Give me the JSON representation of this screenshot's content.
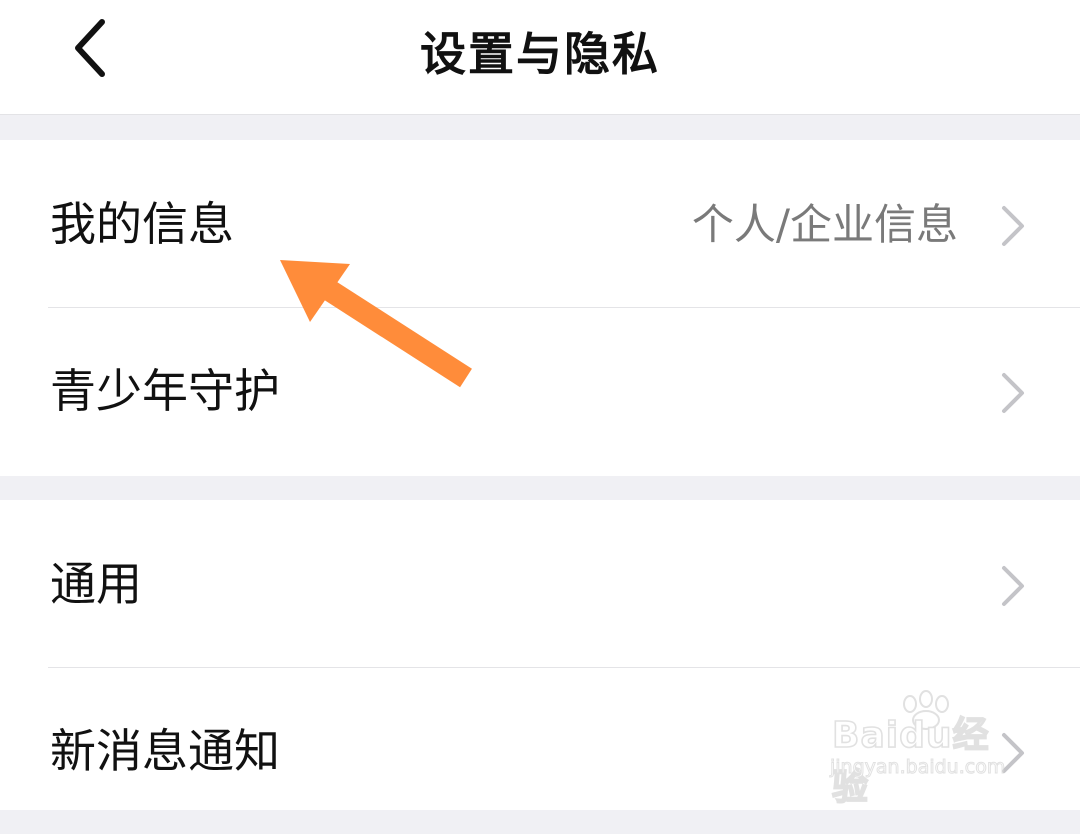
{
  "header": {
    "title": "设置与隐私",
    "back_icon": "chevron-left-icon"
  },
  "groups": [
    {
      "items": [
        {
          "label": "我的信息",
          "value": "个人/企业信息",
          "icon": "chevron-right-icon"
        },
        {
          "label": "青少年守护",
          "value": "",
          "icon": "chevron-right-icon"
        }
      ]
    },
    {
      "items": [
        {
          "label": "通用",
          "value": "",
          "icon": "chevron-right-icon"
        },
        {
          "label": "新消息通知",
          "value": "",
          "icon": "chevron-right-icon"
        }
      ]
    }
  ],
  "annotation": {
    "type": "arrow",
    "color": "#ff8c3a",
    "points_to": "我的信息"
  },
  "watermark": {
    "brand": "Baidu经验",
    "url": "jingyan.baidu.com"
  },
  "colors": {
    "background": "#f0f0f4",
    "surface": "#ffffff",
    "text_primary": "#111111",
    "text_secondary": "#7a7a7a",
    "chevron": "#c4c4c8",
    "arrow": "#ff8c3a"
  }
}
